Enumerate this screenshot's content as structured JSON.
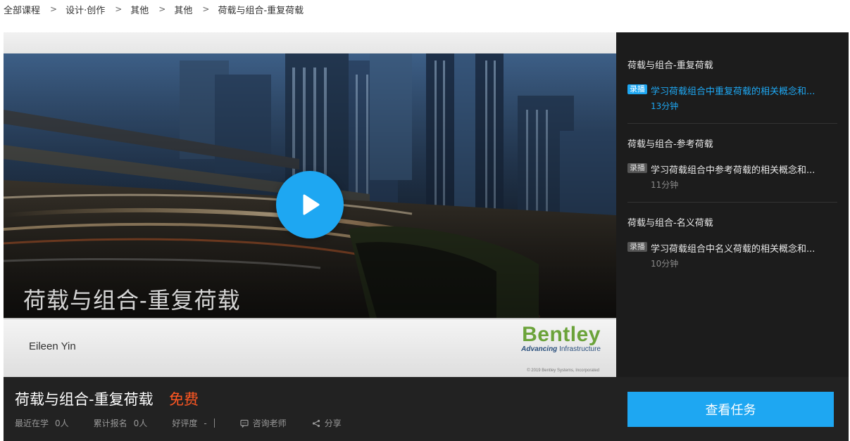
{
  "breadcrumb": {
    "items": [
      "全部课程",
      "设计·创作",
      "其他",
      "其他",
      "荷载与组合-重复荷载"
    ],
    "separator": ">"
  },
  "video": {
    "slide_title": "荷载与组合-重复荷载",
    "presenter": "Eileen Yin",
    "brand_name": "Bentley",
    "brand_tagline_bold": "Advancing",
    "brand_tagline_rest": " Infrastructure",
    "copyright": "© 2019 Bentley Systems, Incorporated"
  },
  "playlist": {
    "sections": [
      {
        "title": "荷载与组合-重复荷载",
        "lesson": {
          "tag": "录播",
          "title": "学习荷载组合中重复荷载的相关概念和...",
          "duration": "13分钟",
          "active": true
        }
      },
      {
        "title": "荷载与组合-参考荷载",
        "lesson": {
          "tag": "录播",
          "title": "学习荷载组合中参考荷载的相关概念和...",
          "duration": "11分钟",
          "active": false
        }
      },
      {
        "title": "荷载与组合-名义荷载",
        "lesson": {
          "tag": "录播",
          "title": "学习荷载组合中名义荷载的相关概念和...",
          "duration": "10分钟",
          "active": false
        }
      }
    ]
  },
  "info": {
    "course_title": "荷载与组合-重复荷载",
    "price": "免费",
    "stats": [
      {
        "label": "最近在学",
        "value": "0人"
      },
      {
        "label": "累计报名",
        "value": "0人"
      },
      {
        "label": "好评度",
        "value": "-"
      }
    ],
    "consult_label": "咨询老师",
    "share_label": "分享",
    "cta_label": "查看任务"
  },
  "colors": {
    "accent": "#1ea7f2",
    "price": "#ff5722",
    "dark_bg": "#222222",
    "playlist_bg": "#1c1c1c",
    "brand_green": "#6ba33a"
  }
}
